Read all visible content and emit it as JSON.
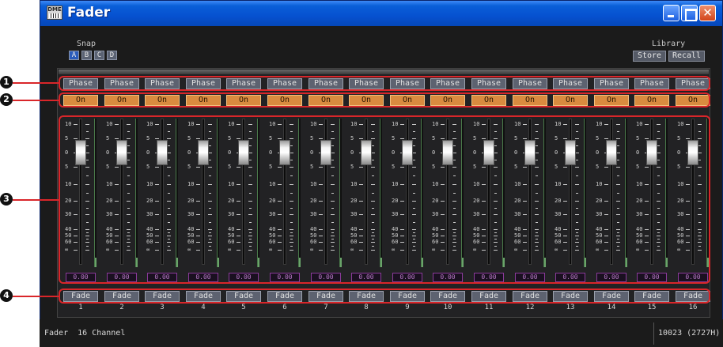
{
  "window": {
    "title": "Fader",
    "app_icon_label": "DME",
    "close_glyph": "✕"
  },
  "snap": {
    "label": "Snap",
    "buttons": [
      "A",
      "B",
      "C",
      "D"
    ],
    "active": "A"
  },
  "library": {
    "label": "Library",
    "store_label": "Store",
    "recall_label": "Recall"
  },
  "channels": [
    {
      "phase": "Phase",
      "on": "On",
      "value": "0.00",
      "fade": "Fade",
      "number": "1"
    },
    {
      "phase": "Phase",
      "on": "On",
      "value": "0.00",
      "fade": "Fade",
      "number": "2"
    },
    {
      "phase": "Phase",
      "on": "On",
      "value": "0.00",
      "fade": "Fade",
      "number": "3"
    },
    {
      "phase": "Phase",
      "on": "On",
      "value": "0.00",
      "fade": "Fade",
      "number": "4"
    },
    {
      "phase": "Phase",
      "on": "On",
      "value": "0.00",
      "fade": "Fade",
      "number": "5"
    },
    {
      "phase": "Phase",
      "on": "On",
      "value": "0.00",
      "fade": "Fade",
      "number": "6"
    },
    {
      "phase": "Phase",
      "on": "On",
      "value": "0.00",
      "fade": "Fade",
      "number": "7"
    },
    {
      "phase": "Phase",
      "on": "On",
      "value": "0.00",
      "fade": "Fade",
      "number": "8"
    },
    {
      "phase": "Phase",
      "on": "On",
      "value": "0.00",
      "fade": "Fade",
      "number": "9"
    },
    {
      "phase": "Phase",
      "on": "On",
      "value": "0.00",
      "fade": "Fade",
      "number": "10"
    },
    {
      "phase": "Phase",
      "on": "On",
      "value": "0.00",
      "fade": "Fade",
      "number": "11"
    },
    {
      "phase": "Phase",
      "on": "On",
      "value": "0.00",
      "fade": "Fade",
      "number": "12"
    },
    {
      "phase": "Phase",
      "on": "On",
      "value": "0.00",
      "fade": "Fade",
      "number": "13"
    },
    {
      "phase": "Phase",
      "on": "On",
      "value": "0.00",
      "fade": "Fade",
      "number": "14"
    },
    {
      "phase": "Phase",
      "on": "On",
      "value": "0.00",
      "fade": "Fade",
      "number": "15"
    },
    {
      "phase": "Phase",
      "on": "On",
      "value": "0.00",
      "fade": "Fade",
      "number": "16"
    }
  ],
  "fader_scale": [
    "10",
    "5",
    "0",
    "5",
    "10",
    "20",
    "30",
    "40",
    "50",
    "60",
    "∞"
  ],
  "fader_level_db": 0,
  "callouts": [
    "1",
    "2",
    "3",
    "4"
  ],
  "status": {
    "left": "Fader  16 Channel",
    "right": "10023 (2727H)"
  },
  "colors": {
    "on_button": "#d98b3f",
    "value_text": "#b978c8",
    "highlight": "#d9262a",
    "titlebar": "#0651d0"
  }
}
